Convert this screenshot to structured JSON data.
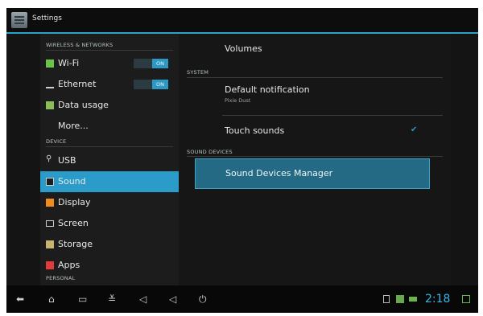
{
  "app": {
    "title": "Settings"
  },
  "sidebar": {
    "headers": {
      "wireless": "WIRELESS & NETWORKS",
      "device": "DEVICE",
      "personal": "PERSONAL"
    },
    "items": [
      {
        "label": "Wi-Fi",
        "toggle": "ON"
      },
      {
        "label": "Ethernet",
        "toggle": "ON"
      },
      {
        "label": "Data usage"
      },
      {
        "label": "More..."
      },
      {
        "label": "USB"
      },
      {
        "label": "Sound",
        "selected": true
      },
      {
        "label": "Display"
      },
      {
        "label": "Screen"
      },
      {
        "label": "Storage"
      },
      {
        "label": "Apps"
      }
    ]
  },
  "main": {
    "volumes_label": "Volumes",
    "system_header": "SYSTEM",
    "default_notification": {
      "title": "Default notification",
      "value": "Pixie Dust"
    },
    "touch_sounds": {
      "label": "Touch sounds",
      "checked": true
    },
    "sound_devices_header": "SOUND DEVICES",
    "sound_devices_manager_label": "Sound Devices Manager"
  },
  "navbar": {
    "clock": "2:18"
  },
  "colors": {
    "accent": "#2b9cc9",
    "clock": "#36b7e8"
  },
  "icons": [
    "back-icon",
    "home-icon",
    "recent-apps-icon",
    "expand-icon",
    "volume-down-icon",
    "volume-up-icon",
    "power-icon",
    "usb-status-icon",
    "notification-icon",
    "battery-icon",
    "network-icon"
  ]
}
